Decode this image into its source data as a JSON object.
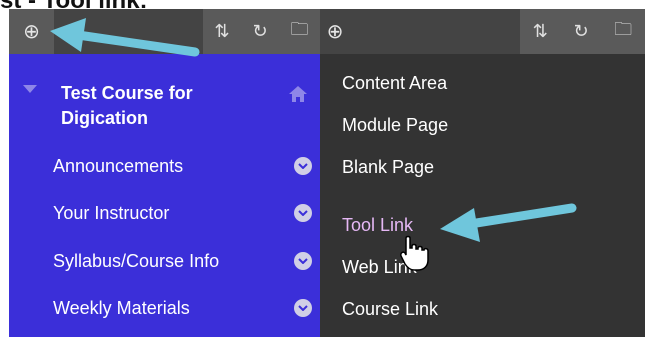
{
  "caption": "st - Tool link:",
  "toolbar": {
    "add_icon": "plus-circle-icon",
    "reorder_icon": "reorder-arrows-icon",
    "refresh_icon": "refresh-icon",
    "folder_icon": "folder-icon",
    "plus_glyph": "⊕",
    "reorder_glyph": "⇅",
    "refresh_glyph": "↻",
    "folder_glyph": "🗀"
  },
  "course_menu": {
    "title": "Test Course for Digication",
    "items": [
      {
        "label": "Announcements"
      },
      {
        "label": "Your Instructor"
      },
      {
        "label": "Syllabus/Course Info"
      },
      {
        "label": "Weekly Materials"
      }
    ]
  },
  "add_menu": {
    "items": [
      {
        "label": "Content Area"
      },
      {
        "label": "Module Page"
      },
      {
        "label": "Blank Page"
      },
      {
        "label": "Tool Link"
      },
      {
        "label": "Web Link"
      },
      {
        "label": "Course Link"
      }
    ],
    "highlighted": "Tool Link"
  },
  "colors": {
    "menu_bg": "#3b2fd9",
    "toolbar_bg": "#444444",
    "dropdown_bg": "#333333",
    "arrow": "#6fc6dc",
    "hover_text": "#e6b8f5"
  }
}
